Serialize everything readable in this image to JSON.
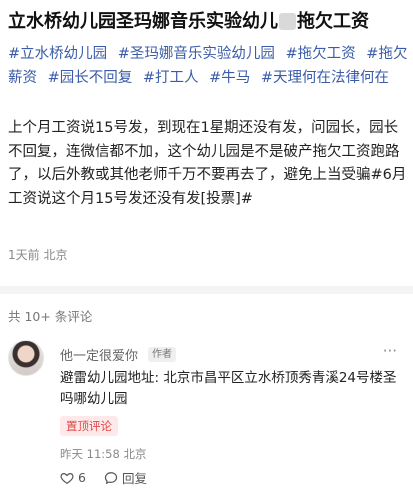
{
  "post": {
    "title_before": "立水桥幼儿园圣玛娜音乐实验幼儿",
    "title_after": "拖欠工资",
    "tags": [
      "#立水桥幼儿园",
      "#圣玛娜音乐实验幼儿园",
      "#拖欠工资",
      "#拖欠薪资",
      "#园长不回复",
      "#打工人",
      "#牛马",
      "#天理何在法律何在"
    ],
    "body": "上个月工资说15号发，到现在1星期还没有发，问园长，园长不回复，连微信都不加，这个幼儿园是不是破产拖欠工资跑路了，以后外教或其他老师千万不要再去了，避免上当受骗#6月工资说这个月15号发还没有发[投票]#",
    "meta": "1天前 北京"
  },
  "comments_summary": {
    "count_label": "共 10+ 条评论"
  },
  "comment": {
    "username": "他一定很爱你",
    "author_badge": "作者",
    "more": "···",
    "text": "避雷幼儿园地址: 北京市昌平区立水桥顶秀青溪24号楼圣吗哪幼儿园",
    "pinned_label": "置顶评论",
    "time": "昨天 11:58 北京",
    "likes": "6",
    "reply_label": "回复"
  }
}
